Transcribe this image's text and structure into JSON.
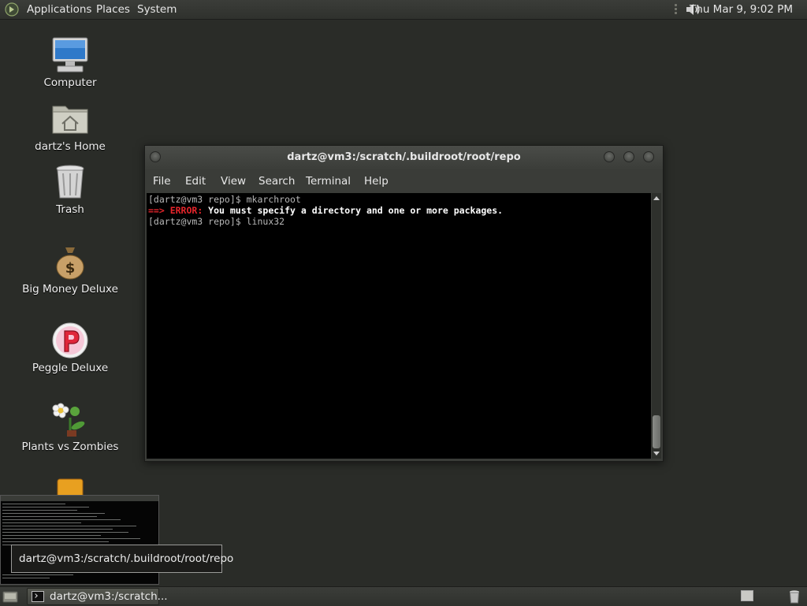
{
  "top_panel": {
    "applications": "Applications",
    "places": "Places",
    "system": "System",
    "clock": "Thu Mar  9,  9:02 PM"
  },
  "desktop_icons": {
    "computer": "Computer",
    "home": "dartz's Home",
    "trash": "Trash",
    "big_money": "Big Money Deluxe",
    "peggle": "Peggle Deluxe",
    "plants": "Plants vs Zombies"
  },
  "terminal": {
    "title": "dartz@vm3:/scratch/.buildroot/root/repo",
    "menu": {
      "file": "File",
      "edit": "Edit",
      "view": "View",
      "search": "Search",
      "terminal": "Terminal",
      "help": "Help"
    },
    "line1": "[dartz@vm3 repo]$ mkarchroot",
    "line2_arrow": "==> ",
    "line2_error": "ERROR:",
    "line2_message": " You must specify a directory and one or more packages.",
    "line3": "[dartz@vm3 repo]$ linux32"
  },
  "tooltip": "dartz@vm3:/scratch/.buildroot/root/repo",
  "taskbar": {
    "terminal_button": "dartz@vm3:/scratch..."
  },
  "colors": {
    "desktop": "#2a2c28",
    "panel": "#363834",
    "error_red": "#e8252b"
  }
}
